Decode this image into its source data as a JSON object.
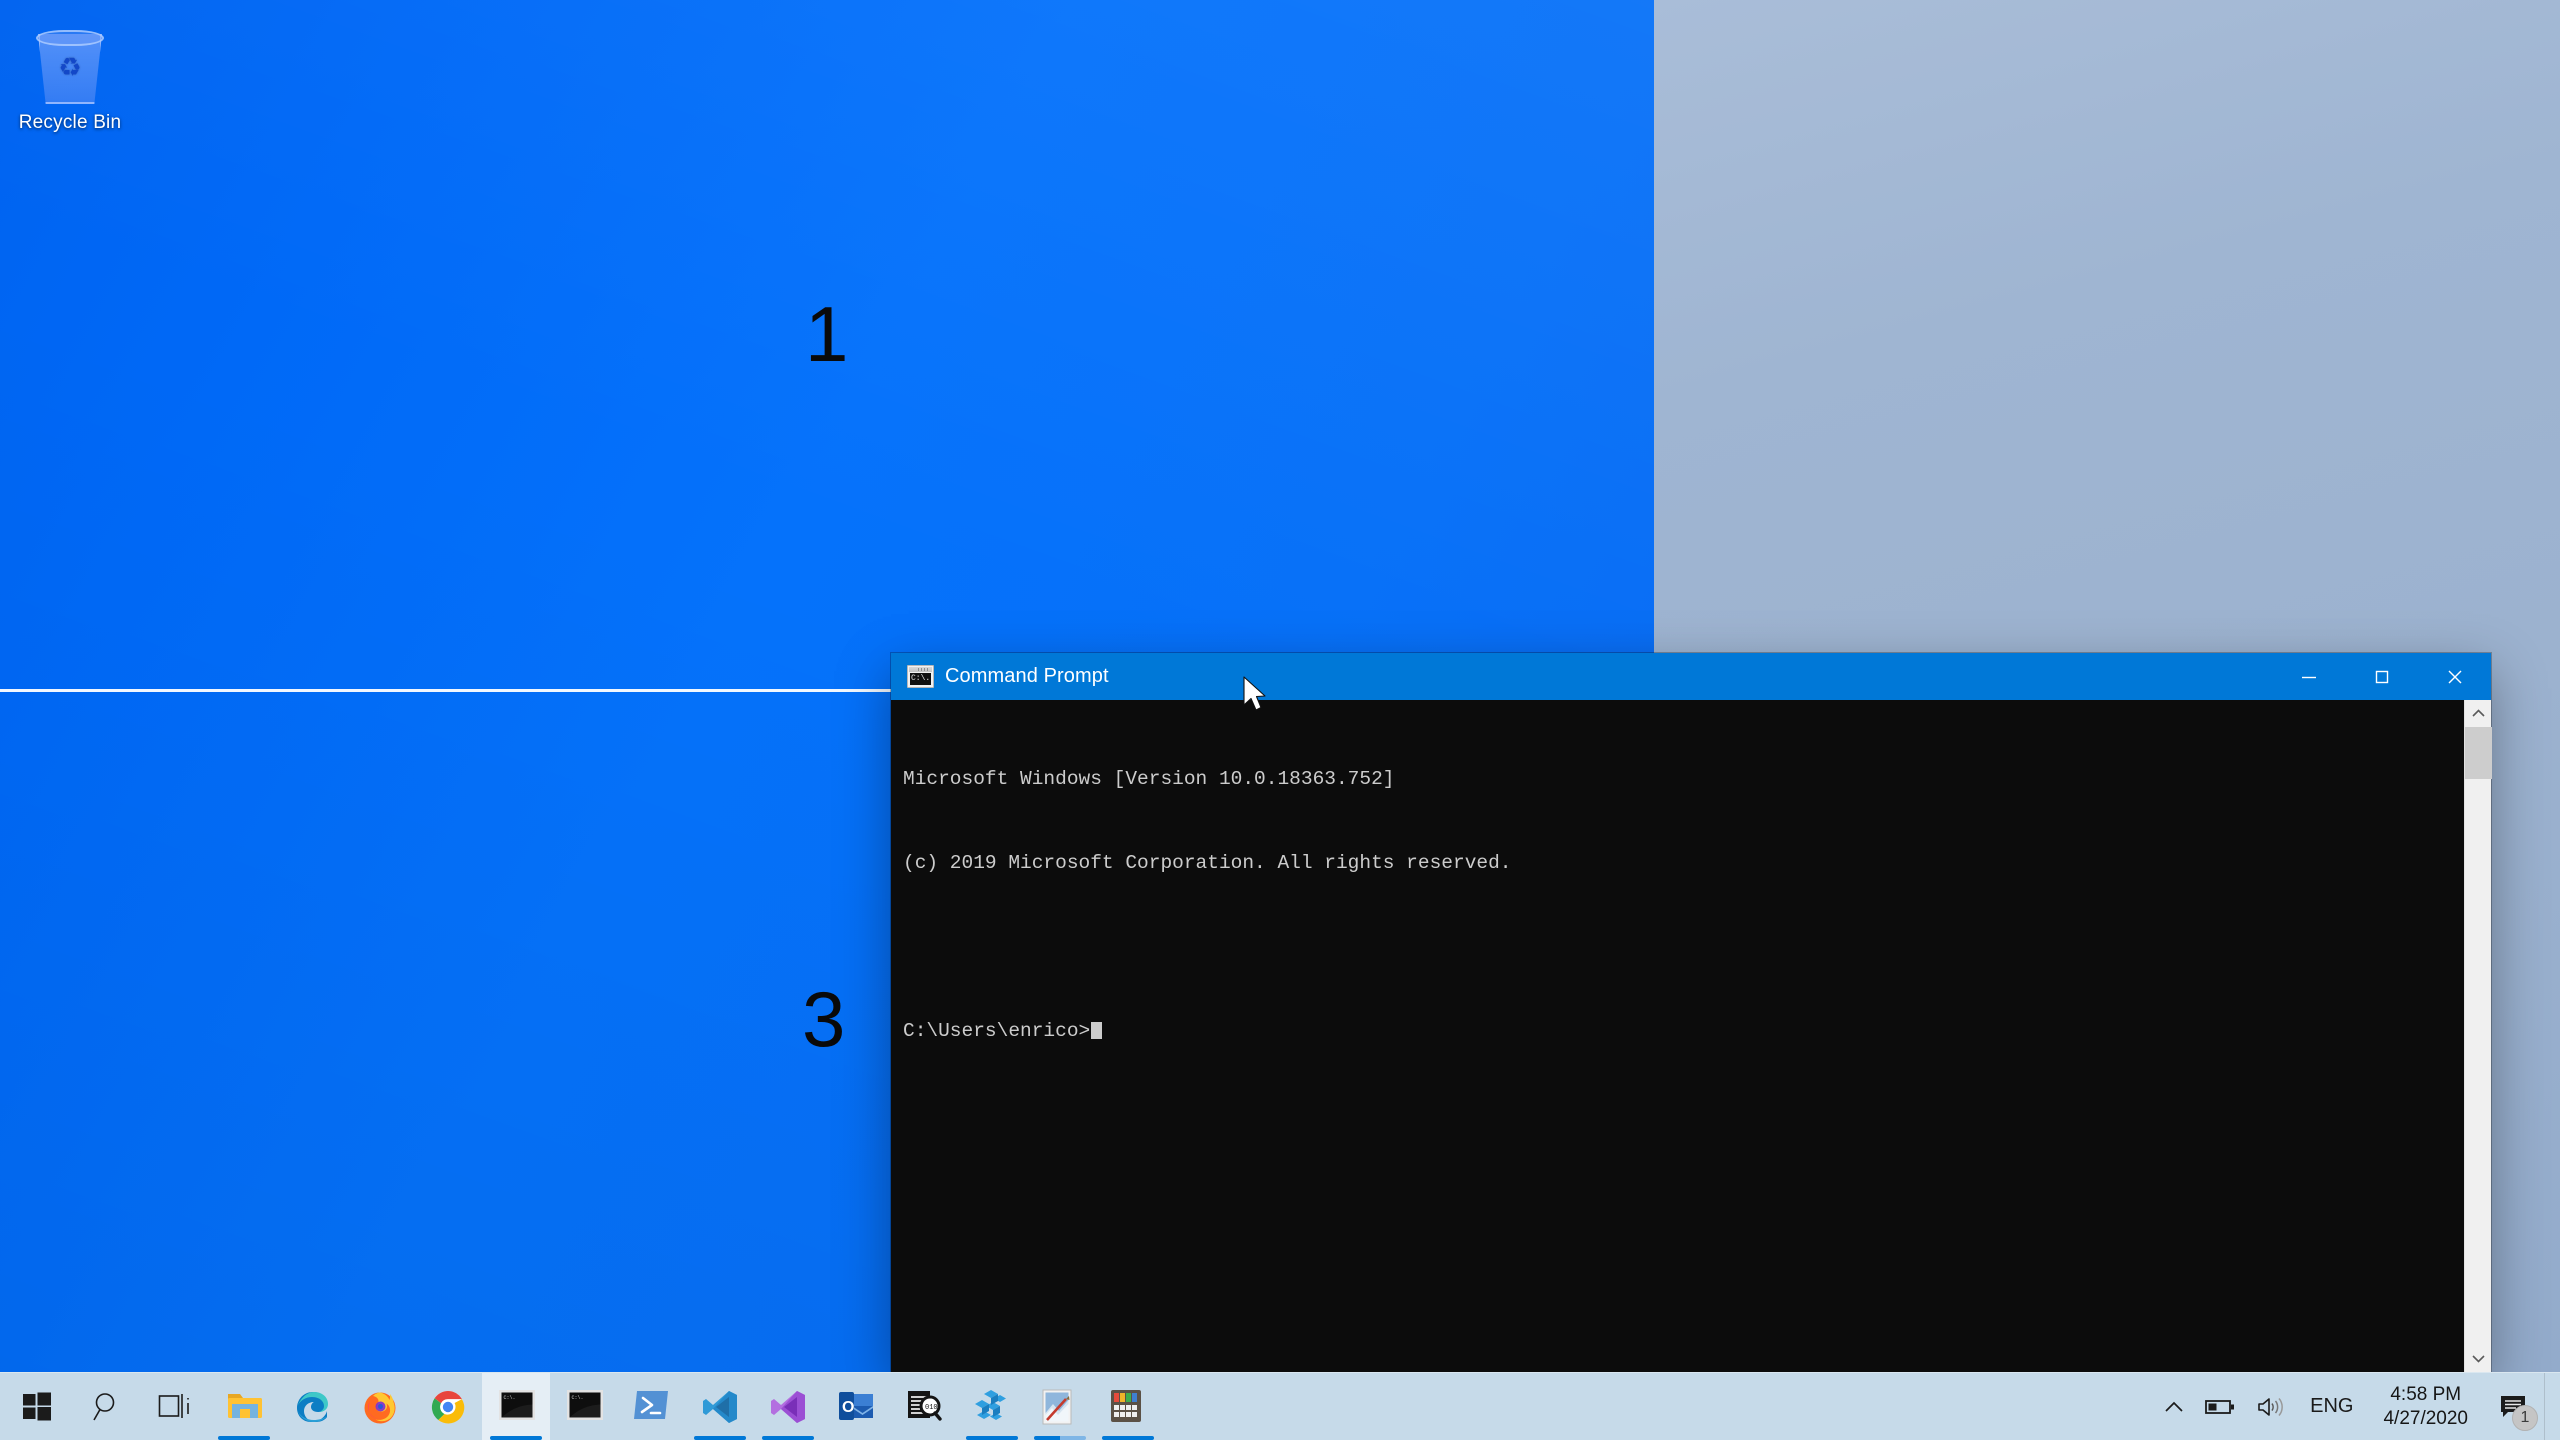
{
  "desktop": {
    "recycle_bin": {
      "label": "Recycle Bin",
      "icon": "recycle-bin-icon"
    },
    "annotations": [
      {
        "text": "1"
      },
      {
        "text": "3"
      }
    ],
    "wallpaper_accent": "#0670f8"
  },
  "cmd_window": {
    "title": "Command Prompt",
    "icon": "console-icon",
    "controls": {
      "minimize": "Minimize",
      "maximize": "Maximize",
      "close": "Close"
    },
    "console_lines": [
      "Microsoft Windows [Version 10.0.18363.752]",
      "(c) 2019 Microsoft Corporation. All rights reserved.",
      "",
      "C:\\Users\\enrico>"
    ],
    "prompt": "C:\\Users\\enrico>",
    "scrollbar": {
      "up": "scroll-up",
      "down": "scroll-down"
    },
    "colors": {
      "titlebar": "#0078d7",
      "background": "#0c0c0c",
      "text": "#cccccc"
    }
  },
  "taskbar": {
    "background": "#c6dae9",
    "accent": "#0078d7",
    "items": [
      {
        "name": "start-button",
        "icon": "windows-logo-icon",
        "label": "Start",
        "state": "idle"
      },
      {
        "name": "search-button",
        "icon": "search-icon",
        "label": "Search",
        "state": "idle"
      },
      {
        "name": "task-view-button",
        "icon": "task-view-icon",
        "label": "Task View",
        "state": "idle"
      },
      {
        "name": "file-explorer",
        "icon": "folder-icon",
        "label": "File Explorer",
        "state": "running"
      },
      {
        "name": "microsoft-edge",
        "icon": "edge-icon",
        "label": "Microsoft Edge",
        "state": "idle"
      },
      {
        "name": "firefox",
        "icon": "firefox-icon",
        "label": "Mozilla Firefox",
        "state": "idle"
      },
      {
        "name": "google-chrome",
        "icon": "chrome-icon",
        "label": "Google Chrome",
        "state": "idle"
      },
      {
        "name": "command-prompt-1",
        "icon": "console-icon",
        "label": "Command Prompt",
        "state": "active"
      },
      {
        "name": "command-prompt-2",
        "icon": "console-icon",
        "label": "Command Prompt",
        "state": "idle"
      },
      {
        "name": "powershell",
        "icon": "powershell-icon",
        "label": "Windows PowerShell",
        "state": "idle"
      },
      {
        "name": "vs-code",
        "icon": "vscode-icon",
        "label": "Visual Studio Code",
        "state": "running"
      },
      {
        "name": "visual-studio",
        "icon": "visual-studio-icon",
        "label": "Visual Studio",
        "state": "running"
      },
      {
        "name": "outlook",
        "icon": "outlook-icon",
        "label": "Outlook",
        "state": "idle"
      },
      {
        "name": "log-viewer",
        "icon": "document-search-icon",
        "label": "Log Viewer",
        "state": "idle"
      },
      {
        "name": "blue-cubes-app",
        "icon": "cubes-icon",
        "label": "Blue Cubes",
        "state": "running"
      },
      {
        "name": "paint",
        "icon": "paint-icon",
        "label": "Paint",
        "state": "running-multi"
      },
      {
        "name": "calculator",
        "icon": "calculator-icon",
        "label": "Calculator",
        "state": "running"
      }
    ]
  },
  "tray": {
    "show_hidden_icons": "show-hidden-icons",
    "battery": "battery-icon",
    "volume": "volume-icon",
    "language": "ENG",
    "time": "4:58 PM",
    "date": "4/27/2020",
    "notifications": {
      "icon": "notification-icon",
      "count": "1"
    }
  }
}
